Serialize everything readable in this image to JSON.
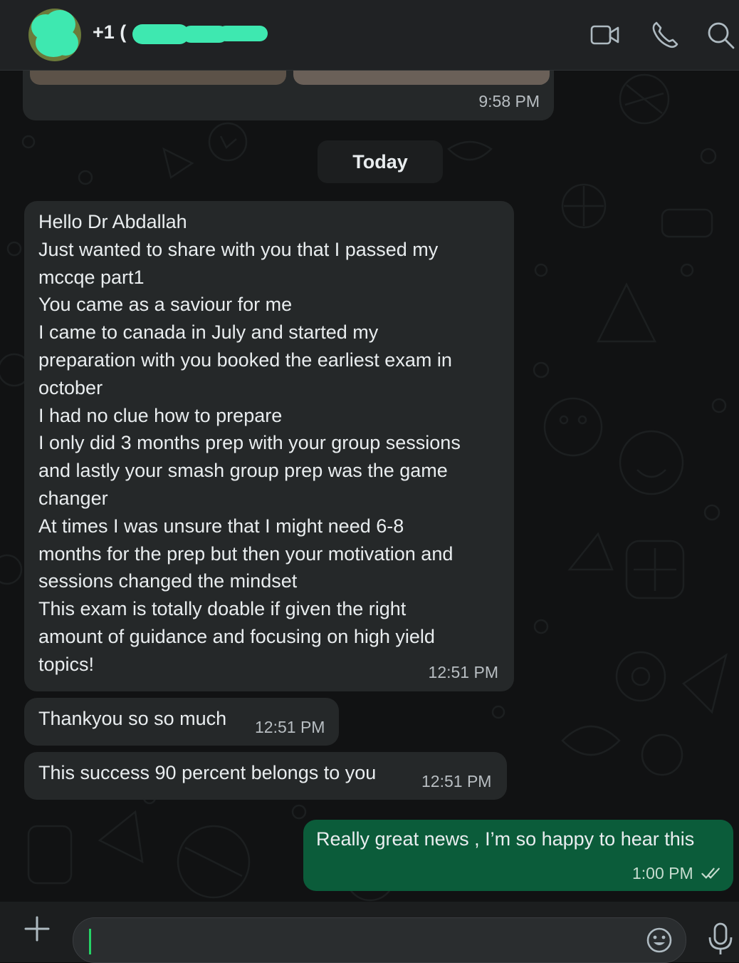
{
  "header": {
    "contact_prefix": "+1 (",
    "icons": [
      "video-call-icon",
      "voice-call-icon",
      "search-icon"
    ]
  },
  "messages": {
    "prev_time": "9:58 PM",
    "date_separator": "Today",
    "msg1": {
      "text": "Hello Dr Abdallah\nJust wanted to share with you that I passed my\nmccqe part1\nYou came as a saviour for me\nI came to canada in July and started my\npreparation with you booked the earliest exam in\noctober\nI had no clue how to prepare\nI only did 3 months prep with your group sessions\nand lastly your smash group prep was the game\nchanger\nAt times I was unsure that I might need 6-8\nmonths for the prep but then your motivation and\nsessions changed the mindset\nThis exam is totally doable if given the right\namount of guidance and focusing on high yield\ntopics!",
      "time": "12:51 PM"
    },
    "msg2": {
      "text": "Thankyou so so much",
      "time": "12:51 PM"
    },
    "msg3": {
      "text": "This success 90 percent belongs to you",
      "time": "12:51 PM"
    },
    "msg4": {
      "text": "Really great news , I’m so happy to hear this",
      "time": "1:00 PM"
    }
  },
  "composer": {
    "value": "",
    "placeholder": ""
  },
  "colors": {
    "accent": "#25d366",
    "outgoing_bubble": "#0b5c3a",
    "incoming_bubble": "#252829"
  }
}
